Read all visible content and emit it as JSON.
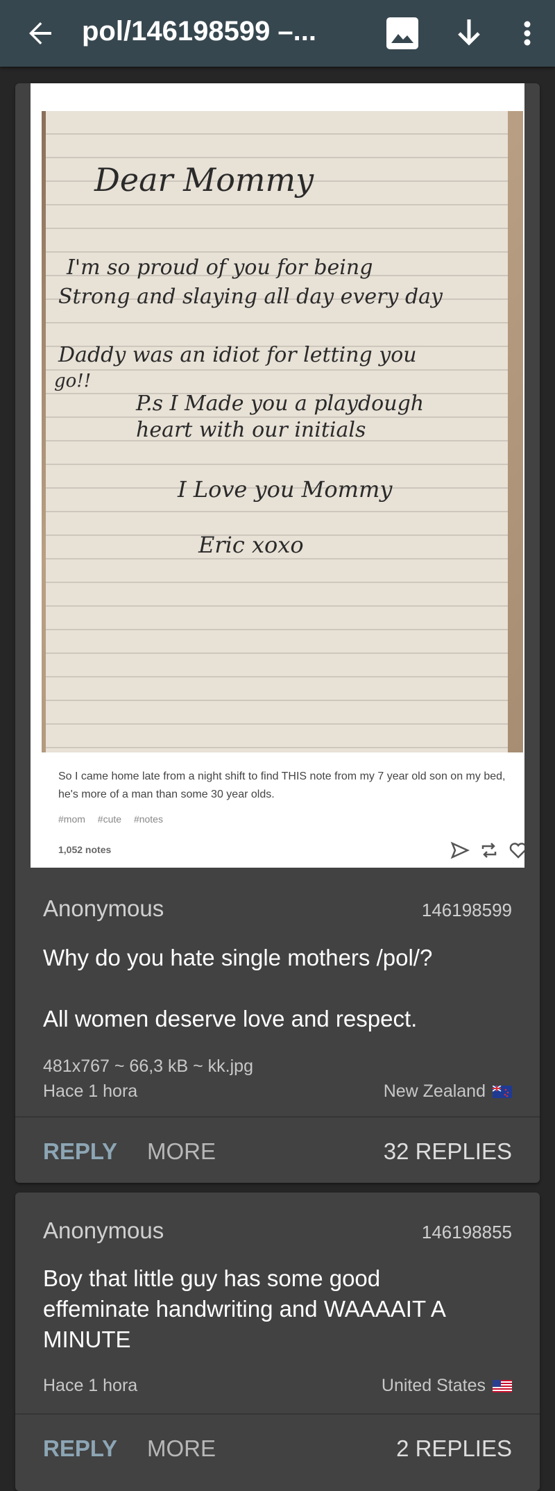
{
  "appbar": {
    "title": "pol/146198599 –...",
    "icons": [
      "arrow-back-icon",
      "image-icon",
      "download-icon",
      "more-vert-icon"
    ]
  },
  "image_post": {
    "note_lines": [
      "Dear Mommy",
      "I'm so proud of you for being",
      "Strong and slaying all day every day",
      "Daddy was an idiot for letting you",
      "go!!",
      "P.s I Made you a playdough",
      "heart with our initials",
      "I Love you Mommy",
      "Eric xoxo"
    ],
    "caption": "So I came home late from a night shift to find THIS note from my 7 year old son on my bed, he's more of a man than some 30 year olds.",
    "tags": [
      "#mom",
      "#cute",
      "#notes"
    ],
    "notes": "1,052 notes"
  },
  "posts": [
    {
      "author": "Anonymous",
      "number": "146198599",
      "comment_lines": [
        "Why do you hate single mothers /pol/?",
        "",
        "All women deserve love and respect."
      ],
      "file_info": "481x767 ~ 66,3 kB ~ kk.jpg",
      "time": "Hace 1 hora",
      "country": "New Zealand",
      "reply_label": "REPLY",
      "more_label": "MORE",
      "replies_label": "32 REPLIES"
    },
    {
      "author": "Anonymous",
      "number": "146198855",
      "comment_lines": [
        "Boy that little guy has some good",
        "effeminate handwriting and WAAAAIT A",
        "MINUTE"
      ],
      "time": "Hace 1 hora",
      "country": "United States",
      "reply_label": "REPLY",
      "more_label": "MORE",
      "replies_label": "2 REPLIES"
    }
  ]
}
